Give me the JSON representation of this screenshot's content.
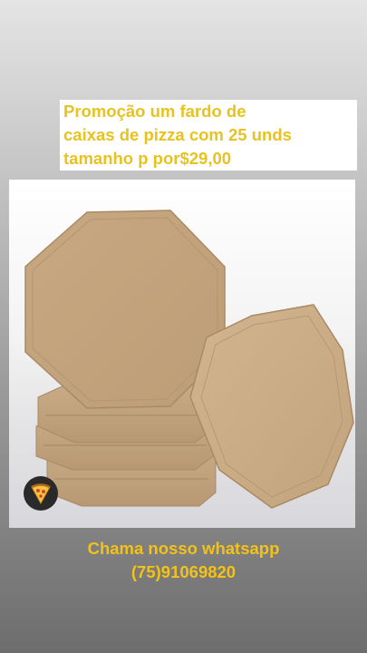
{
  "promo": {
    "line1": "Promoção um fardo de",
    "line2": "caixas de pizza com 25 unds",
    "line3": "tamanho p por$29,00"
  },
  "contact": {
    "line1": "Chama nosso whatsapp",
    "line2": "(75)91069820"
  },
  "sticker": {
    "icon": "pizza-slice-icon"
  },
  "colors": {
    "caption_text": "#e8c21e",
    "caption_background": "#ffffff",
    "cardboard": "#c9ab84"
  }
}
